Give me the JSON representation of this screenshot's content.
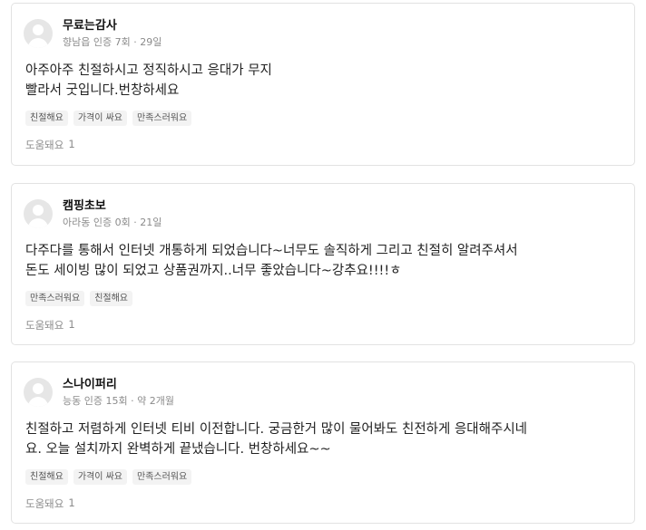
{
  "reviews": [
    {
      "author": "무료는감사",
      "location": "향남읍",
      "cert": "인증 7회",
      "date": "29일",
      "text_lines": [
        "아주아주 친절하시고 정직하시고 응대가 무지",
        "빨라서 굿입니다.번창하세요"
      ],
      "tags": [
        "친절해요",
        "가격이 싸요",
        "만족스러워요"
      ],
      "helpful_label": "도움돼요",
      "helpful_count": "1"
    },
    {
      "author": "캠핑초보",
      "location": "아라동",
      "cert": "인증 0회",
      "date": "21일",
      "text_lines": [
        "다주다를 통해서 인터넷 개통하게 되었습니다~너무도 솔직하게 그리고 친절히 알려주셔서",
        "돈도 세이빙 많이 되었고 상품권까지..너무 좋았습니다~강추요!!!!ㅎ"
      ],
      "tags": [
        "만족스러워요",
        "친절해요"
      ],
      "helpful_label": "도움돼요",
      "helpful_count": "1"
    },
    {
      "author": "스나이퍼리",
      "location": "능동",
      "cert": "인증 15회",
      "date": "약 2개월",
      "text_lines": [
        "친절하고 저렴하게 인터넷 티비 이전합니다. 궁금한거 많이 물어봐도 친전하게 응대해주시네",
        "요. 오늘 설치까지 완벽하게 끝냈습니다. 번창하세요~~"
      ],
      "tags": [
        "친절해요",
        "가격이 싸요",
        "만족스러워요"
      ],
      "helpful_label": "도움돼요",
      "helpful_count": "1"
    }
  ]
}
